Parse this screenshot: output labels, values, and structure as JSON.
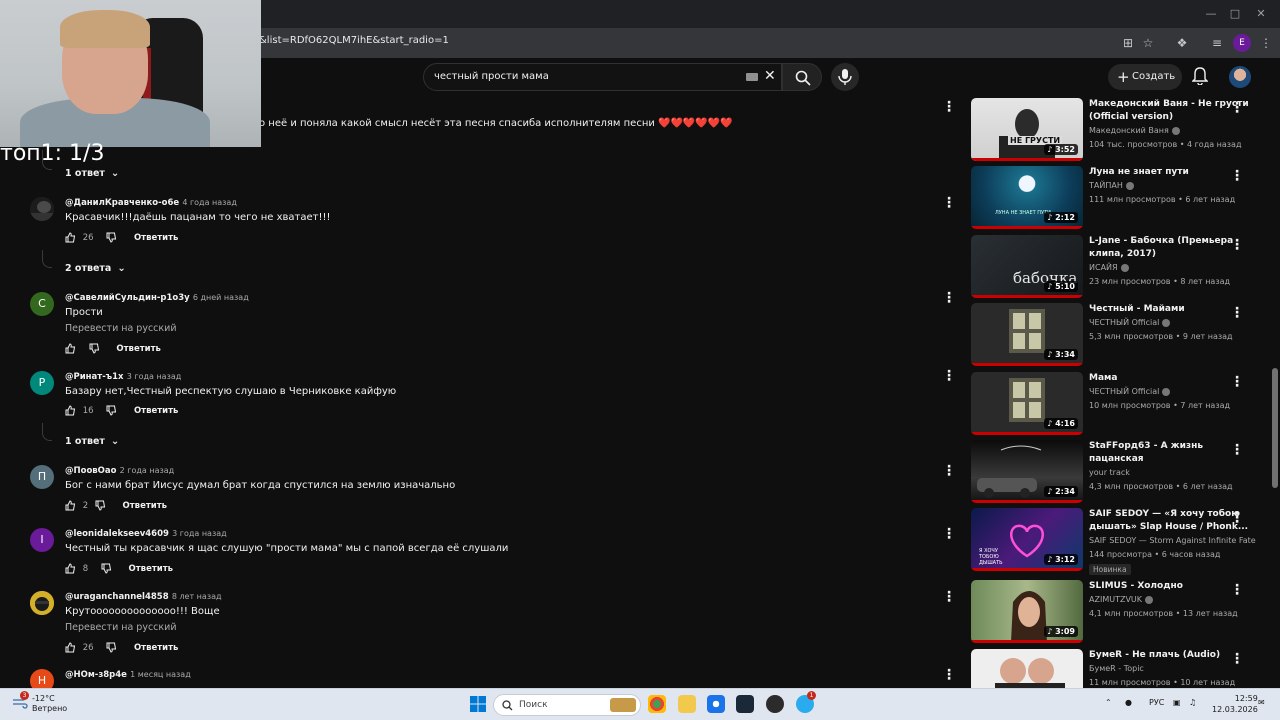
{
  "browser": {
    "url_fragment": "&list=RDfO62QLM7ihE&start_radio=1",
    "profile_letter": "E"
  },
  "header": {
    "search_query": "честный прости мама",
    "create_label": "Создать"
  },
  "overlay": {
    "webcam_text": "топ1: 1/3"
  },
  "partial_comment": {
    "text": "о неё и поняла какой смысл несёт эта песня спасиба исполнителям песни ❤️❤️❤️❤️❤️❤️"
  },
  "comments": [
    {
      "replies_only": true,
      "replies_label": "1 ответ"
    },
    {
      "author": "@ДанилКравченко-о6е",
      "ago": "4 года назад",
      "text": "Красавчик!!!даёшь пацанам то чего не хватает!!!",
      "likes": "26",
      "reply_label": "Ответить",
      "replies_label": "2 ответа",
      "avatar_letter": "",
      "avatar_color": "#2a2a2a"
    },
    {
      "author": "@СавелийСульдин-р1о3у",
      "ago": "6 дней назад",
      "text": "Прости",
      "translate": "Перевести на русский",
      "likes": "",
      "reply_label": "Ответить",
      "avatar_letter": "С",
      "avatar_color": "#33691e"
    },
    {
      "author": "@Ринат-ъ1х",
      "ago": "3 года назад",
      "text": "Базару нет,Честный респектую слушаю в Черниковке кайфую",
      "likes": "16",
      "reply_label": "Ответить",
      "replies_label": "1 ответ",
      "avatar_letter": "Р",
      "avatar_color": "#00897b"
    },
    {
      "author": "@ПоовОао",
      "ago": "2 года назад",
      "text": "Бог с нами брат Иисус думал брат когда спустился на землю изначально",
      "likes": "2",
      "reply_label": "Ответить",
      "avatar_letter": "П",
      "avatar_color": "#546e7a"
    },
    {
      "author": "@leonidalekseev4609",
      "ago": "3 года назад",
      "text": "Честный ты красавчик я щас слушую \"прости мама\" мы с папой всегда её слушали",
      "likes": "8",
      "reply_label": "Ответить",
      "avatar_letter": "I",
      "avatar_color": "#6a1b9a"
    },
    {
      "author": "@uraganchannel4858",
      "ago": "8 лет назад",
      "text": "Крутоооооооооооооо!!! Воще",
      "translate": "Перевести на русский",
      "likes": "26",
      "reply_label": "Ответить",
      "avatar_letter": "",
      "avatar_color": "#c9a227"
    },
    {
      "author": "@НОм-з8р4е",
      "ago": "1 месяц назад",
      "avatar_letter": "Н",
      "avatar_color": "#e64a19"
    }
  ],
  "videos": [
    {
      "title": "Македонский Ваня - Не грусти (Official version)",
      "channel": "Македонский Ваня",
      "meta": "104 тыс. просмотров • 4 года назад",
      "duration": "3:52",
      "thumb_text": "НЕ ГРУСТИ",
      "verified": true
    },
    {
      "title": "Луна не знает пути",
      "channel": "ТАЙПАН",
      "meta": "111 млн просмотров • 6 лет назад",
      "duration": "2:12",
      "thumb_text": "ЛУНА НЕ ЗНАЕТ ПУТИ",
      "verified": true
    },
    {
      "title": "L-Jane - Бабочка (Премьера клипа, 2017)",
      "channel": "ИСАЙЯ",
      "meta": "23 млн просмотров • 8 лет назад",
      "duration": "5:10",
      "thumb_text": "бабочка",
      "verified": true
    },
    {
      "title": "Честный - Майами",
      "channel": "ЧЕСТНЫЙ Official",
      "meta": "5,3 млн просмотров • 9 лет назад",
      "duration": "3:34",
      "verified": true
    },
    {
      "title": "Мама",
      "channel": "ЧЕСТНЫЙ Official",
      "meta": "10 млн просмотров • 7 лет назад",
      "duration": "4:16",
      "verified": true
    },
    {
      "title": "StaFFорд63 - А жизнь пацанская",
      "channel": "your track",
      "meta": "4,3 млн просмотров • 6 лет назад",
      "duration": "2:34",
      "verified": false
    },
    {
      "title": "SAIF SEDOY — «Я хочу тобою дышать» Slap House / Phonk...",
      "channel": "SAIF SEDOY — Storm Against Infinite Fate",
      "meta": "144 просмотра • 6 часов назад",
      "duration": "3:12",
      "badge": "Новинка",
      "thumb_text": "Я ХОЧУ ТОБОЮ ДЫШАТЬ",
      "verified": false
    },
    {
      "title": "SLIMUS - Холодно",
      "channel": "AZIMUTZVUK",
      "meta": "4,1 млн просмотров • 13 лет назад",
      "duration": "3:09",
      "verified": true
    },
    {
      "title": "БумеR - Не плачь (Audio)",
      "channel": "БумеR - Topic",
      "meta": "11 млн просмотров • 10 лет назад",
      "duration": "",
      "verified": false
    }
  ],
  "taskbar": {
    "temperature": "-12°C",
    "weather": "Ветрено",
    "search_label": "Поиск",
    "language": "РУС",
    "time": "12:59",
    "date": "12.03.2026",
    "notification_count": "3",
    "telegram_badge": "1"
  },
  "colors": {
    "page_bg": "#0f0f0f",
    "progress_red": "#cc0000",
    "heart_red": "#e53935"
  }
}
